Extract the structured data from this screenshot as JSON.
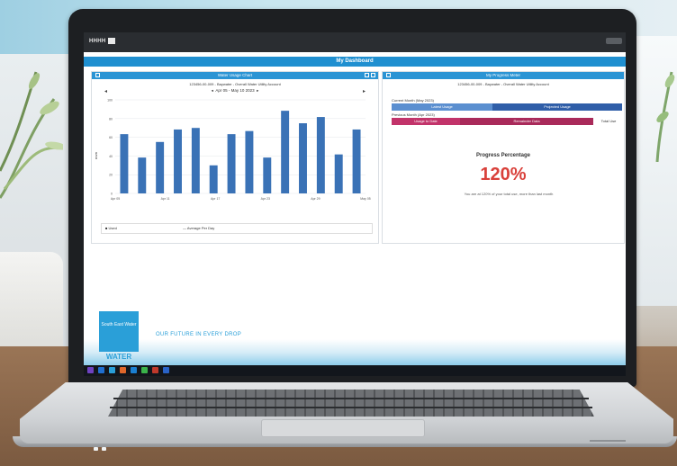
{
  "app": {
    "topbar_logo": "HHHH",
    "page_title": "My Dashboard"
  },
  "left_panel": {
    "title": "Water Usage Chart",
    "subtitle": "123456-00-009 - Baywater - Overall Water Utility Account",
    "date_range": "Apr 05 - May 10 2023",
    "y_ticks": [
      "100",
      "80",
      "60",
      "40",
      "20",
      "0"
    ],
    "y_label": "kWh",
    "x_ticks": [
      "Apr 05",
      "Apr 11",
      "Apr 17",
      "Apr 23",
      "Apr 29",
      "May 05"
    ],
    "legend": {
      "item1": "Used",
      "item2": "Average Per Day"
    }
  },
  "chart_data": {
    "type": "bar",
    "values": [
      38,
      23,
      33,
      41,
      42,
      18,
      38,
      40,
      23,
      53,
      45,
      49,
      25,
      41
    ],
    "ylim": [
      0,
      60
    ],
    "colors": {
      "bar": "#3a72b6"
    }
  },
  "right_panel": {
    "title": "My Progress Meter",
    "subtitle": "123456-00-009 - Baywater - Overall Water Utility Account",
    "current_label": "Current Month (May 2023)",
    "current_bar": {
      "left": "Latest Usage",
      "right": "Projected Usage"
    },
    "previous_label": "Previous Month (Apr 2023)",
    "previous_bar": {
      "left": "Usage to Date",
      "right": "Remainder Data",
      "extra": "Total Use"
    },
    "progress_title": "Progress Percentage",
    "progress_value": "120%",
    "progress_note": "You are at 120% of your total use, more than last month"
  },
  "footer": {
    "logo_text": "South East Water",
    "brand": "WATER",
    "tagline": "OUR FUTURE IN EVERY DROP"
  },
  "taskbar": {
    "icons": [
      "start-icon",
      "edge-icon",
      "folder-icon",
      "store-icon",
      "mail-icon",
      "settings-icon",
      "browser-icon",
      "app-icon"
    ]
  }
}
